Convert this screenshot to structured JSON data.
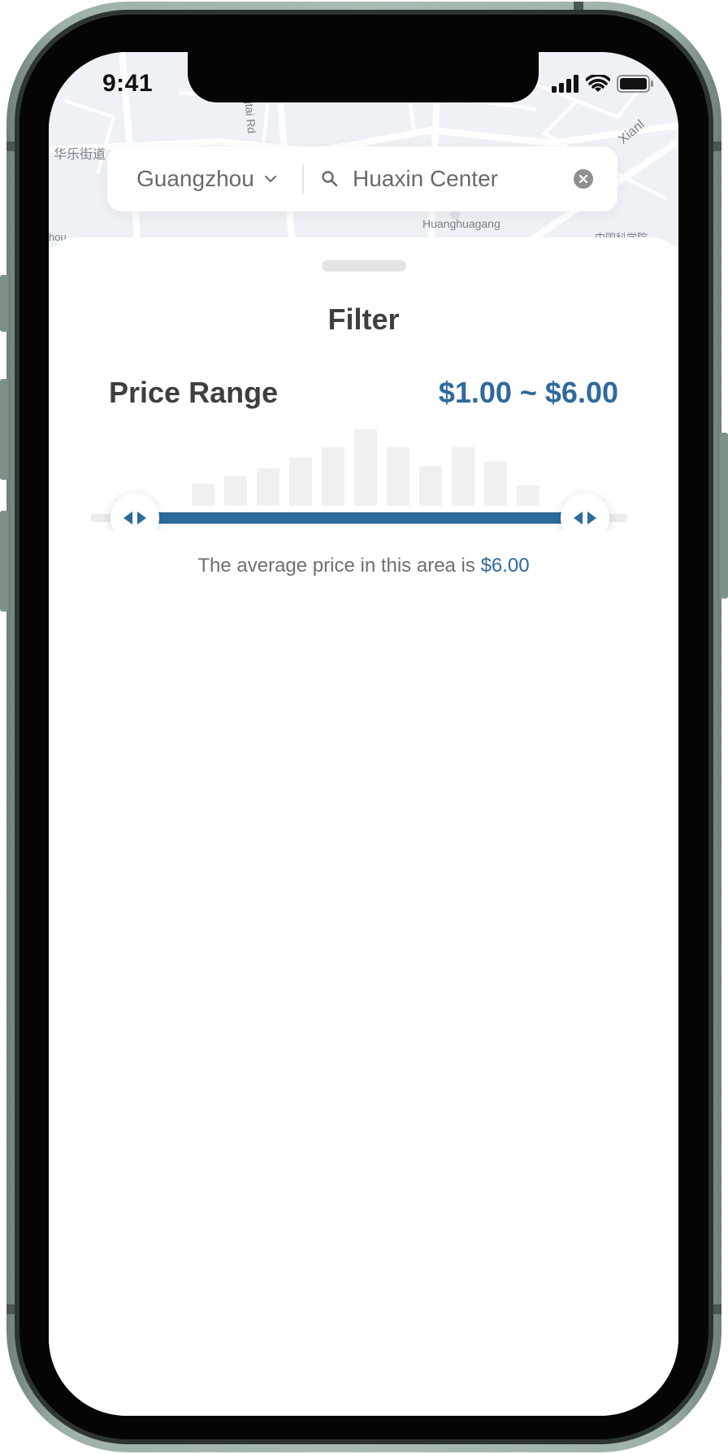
{
  "status_bar": {
    "time": "9:41"
  },
  "map": {
    "labels": [
      "华乐街道",
      "gtai Rd",
      "Xianl",
      "Huanghuagang",
      "中国科学院",
      "hou"
    ]
  },
  "search": {
    "city": "Guangzhou",
    "query": "Huaxin Center"
  },
  "filter": {
    "title": "Filter",
    "price_range_label": "Price Range",
    "price_range_value": "$1.00 ~ $6.00",
    "average_prefix": "The average price in this area is",
    "average_price": "$6.00",
    "slider": {
      "min_fraction": 0.0,
      "max_fraction": 1.0
    },
    "histogram_levels": [
      0.29,
      0.39,
      0.49,
      0.63,
      0.77,
      1.0,
      0.77,
      0.52,
      0.77,
      0.58,
      0.27
    ]
  },
  "colors": {
    "accent": "#2f6a9d",
    "histogram_bar": "#f0f0f0",
    "track": "#ececec",
    "text_dark": "#3f3f3f",
    "text_muted": "#707070"
  },
  "icons": [
    "chevron-down-icon",
    "search-icon",
    "clear-icon",
    "signal-icon",
    "wifi-icon",
    "battery-icon",
    "slider-handle-icon"
  ]
}
